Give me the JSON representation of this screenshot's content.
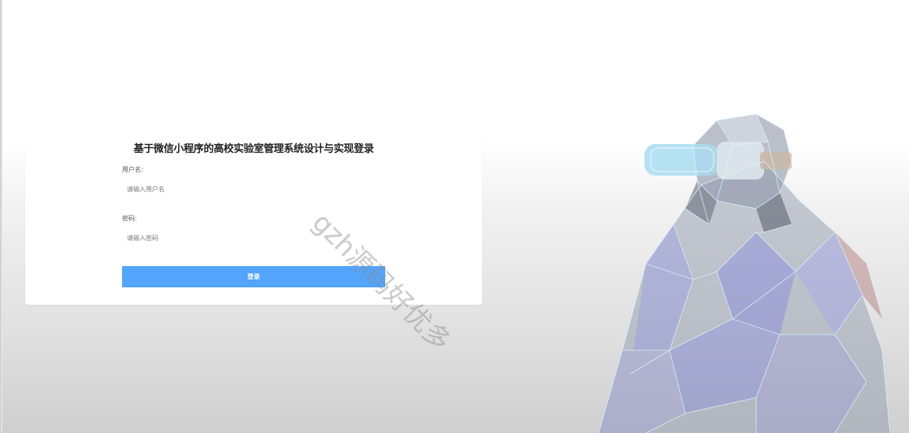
{
  "login": {
    "title": "基于微信小程序的高校实验室管理系统设计与实现登录",
    "username_label": "用户名:",
    "username_placeholder": "请输入用户名",
    "password_label": "密码:",
    "password_placeholder": "请输入密码",
    "submit_label": "登录"
  },
  "watermark": {
    "text": "gzh源码好优多"
  },
  "colors": {
    "button": "#53a4fb",
    "card": "#ffffff"
  }
}
